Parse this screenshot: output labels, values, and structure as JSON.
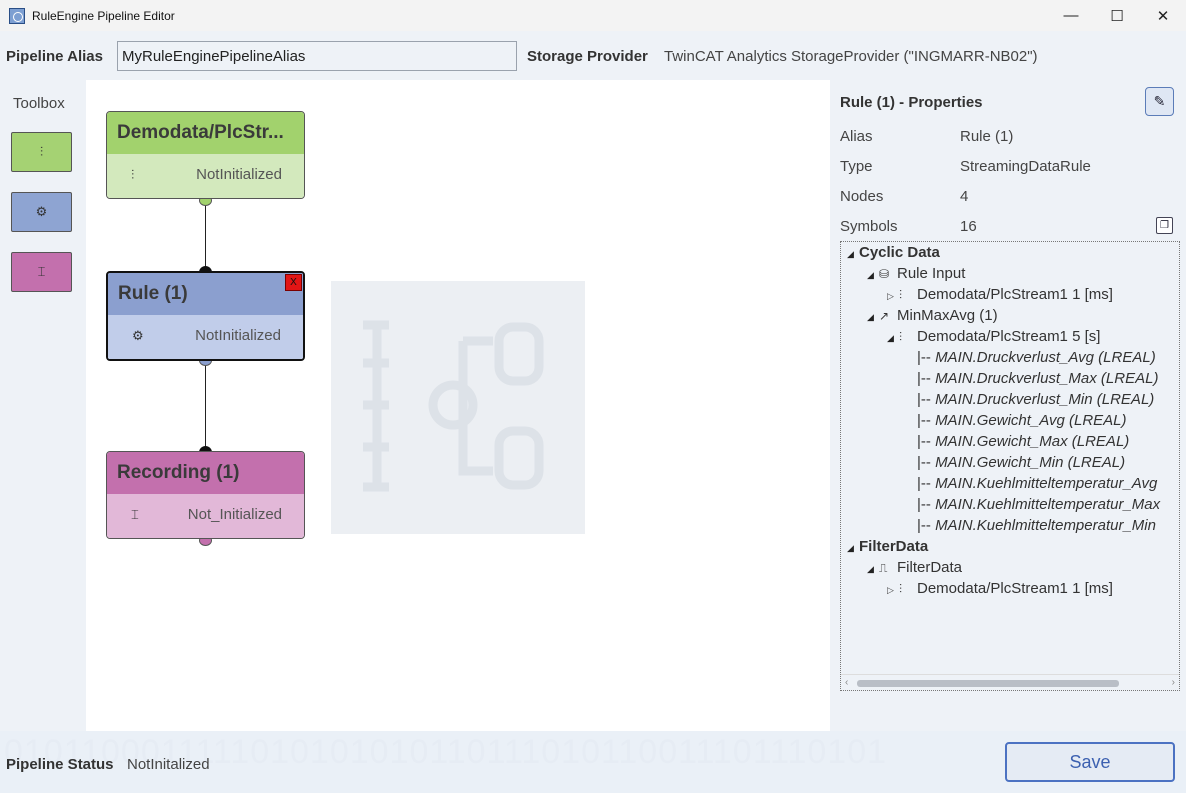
{
  "window": {
    "title": "RuleEngine Pipeline Editor",
    "controls": {
      "minimize": "—",
      "maximize": "☐",
      "close": "✕"
    }
  },
  "header": {
    "alias_label": "Pipeline Alias",
    "alias_value": "MyRuleEnginePipelineAlias",
    "storage_label": "Storage Provider",
    "storage_value": "TwinCAT Analytics StorageProvider (\"INGMARR-NB02\")"
  },
  "toolbox": {
    "label": "Toolbox",
    "items": [
      {
        "icon": "data-stream-icon",
        "glyph": "⫶",
        "color": "#a5d273"
      },
      {
        "icon": "rule-gears-icon",
        "glyph": "⚙",
        "color": "#8ea4d2"
      },
      {
        "icon": "recording-icon",
        "glyph": "⌶",
        "color": "#c370ad"
      }
    ]
  },
  "canvas": {
    "nodes": [
      {
        "title": "Demodata/PlcStr...",
        "status": "NotInitialized",
        "icon": "data-stream-icon",
        "glyph": "⫶",
        "head_color": "#a2d26d",
        "body_color": "#d3e9bd"
      },
      {
        "title": "Rule (1)",
        "status": "NotInitialized",
        "icon": "rule-gears-icon",
        "glyph": "⚙",
        "head_color": "#8b9fcf",
        "body_color": "#c1cdea",
        "close": "X"
      },
      {
        "title": "Recording (1)",
        "status": "Not_Initialized",
        "icon": "recording-icon",
        "glyph": "⌶",
        "head_color": "#c370ad",
        "body_color": "#e2b8d8"
      }
    ]
  },
  "properties": {
    "title": "Rule (1) - Properties",
    "rows": [
      {
        "label": "Alias",
        "value": "Rule (1)"
      },
      {
        "label": "Type",
        "value": "StreamingDataRule"
      },
      {
        "label": "Nodes",
        "value": "4"
      },
      {
        "label": "Symbols",
        "value": "16"
      }
    ],
    "tree": [
      {
        "text": "Cyclic Data",
        "level": 0,
        "arrow": "◢",
        "icon": "",
        "bold": true
      },
      {
        "text": "Rule Input",
        "level": 1,
        "arrow": "◢",
        "icon": "⛁"
      },
      {
        "text": "Demodata/PlcStream1 1 [ms]",
        "level": 2,
        "arrow": "▷",
        "icon": "⫶"
      },
      {
        "text": "MinMaxAvg (1)",
        "level": 1,
        "arrow": "◢",
        "icon": "↗"
      },
      {
        "text": "Demodata/PlcStream1 5 [s]",
        "level": 2,
        "arrow": "◢",
        "icon": "⫶"
      },
      {
        "prefix": "|-- ",
        "text": "MAIN.Druckverlust_Avg  (LREAL)",
        "level": 3,
        "sym": true
      },
      {
        "prefix": "|-- ",
        "text": "MAIN.Druckverlust_Max  (LREAL)",
        "level": 3,
        "sym": true
      },
      {
        "prefix": "|-- ",
        "text": "MAIN.Druckverlust_Min  (LREAL)",
        "level": 3,
        "sym": true
      },
      {
        "prefix": "|-- ",
        "text": "MAIN.Gewicht_Avg  (LREAL)",
        "level": 3,
        "sym": true
      },
      {
        "prefix": "|-- ",
        "text": "MAIN.Gewicht_Max  (LREAL)",
        "level": 3,
        "sym": true
      },
      {
        "prefix": "|-- ",
        "text": "MAIN.Gewicht_Min  (LREAL)",
        "level": 3,
        "sym": true
      },
      {
        "prefix": "|-- ",
        "text": "MAIN.Kuehlmitteltemperatur_Avg",
        "level": 3,
        "sym": true
      },
      {
        "prefix": "|-- ",
        "text": "MAIN.Kuehlmitteltemperatur_Max",
        "level": 3,
        "sym": true
      },
      {
        "prefix": "|-- ",
        "text": "MAIN.Kuehlmitteltemperatur_Min",
        "level": 3,
        "sym": true
      },
      {
        "text": "FilterData",
        "level": 0,
        "arrow": "◢",
        "icon": "",
        "bold": true
      },
      {
        "text": "FilterData",
        "level": 1,
        "arrow": "◢",
        "icon": "⎍"
      },
      {
        "text": "Demodata/PlcStream1 1 [ms]",
        "level": 2,
        "arrow": "▷",
        "icon": "⫶"
      }
    ]
  },
  "footer": {
    "status_label": "Pipeline Status",
    "status_value": "NotInitalized",
    "save_label": "Save",
    "background_pattern": "0101100011111010101010110111010110011101110101"
  }
}
